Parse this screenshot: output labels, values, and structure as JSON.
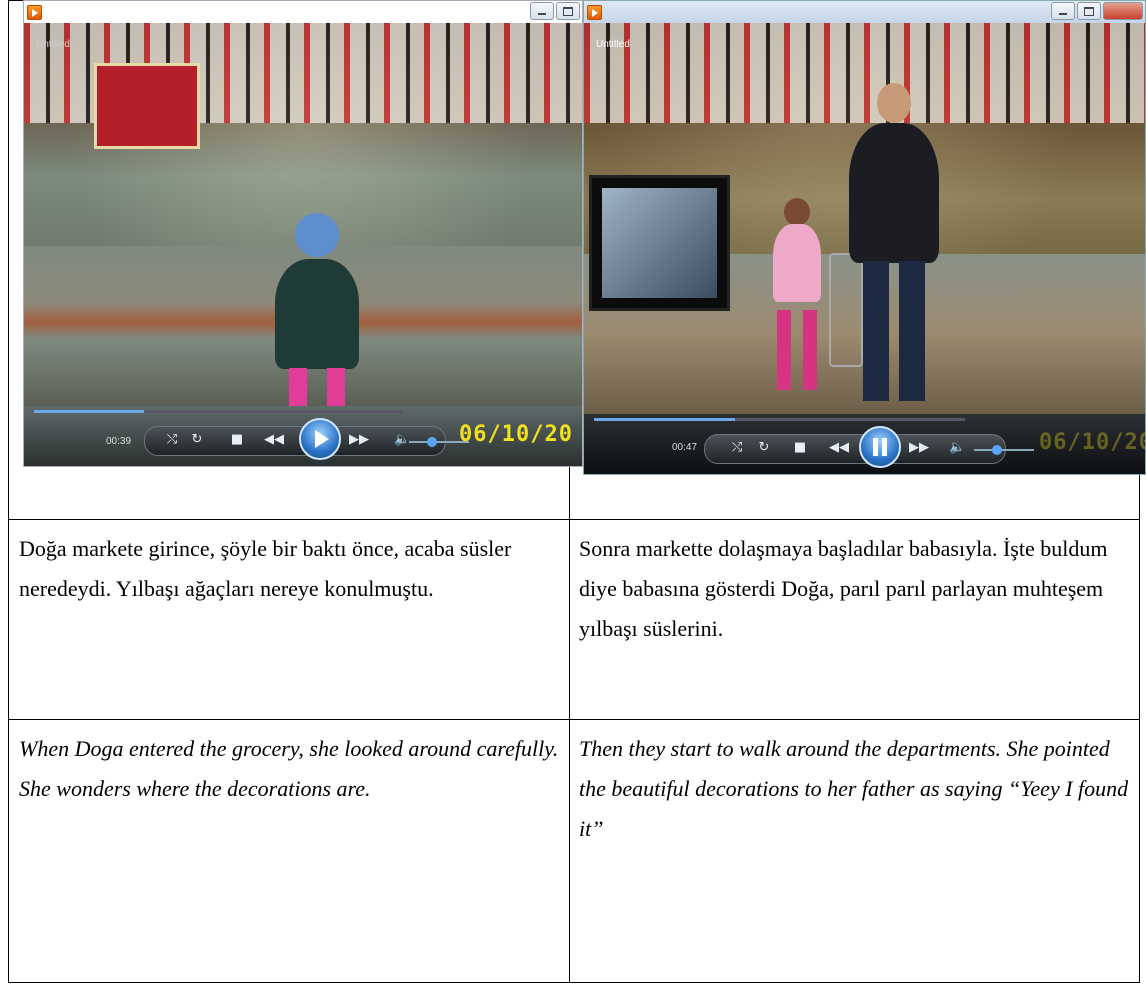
{
  "players": [
    {
      "title": "Untitled",
      "time": "00:39",
      "progress": 0.3,
      "datestamp": "06/10/20",
      "state": "paused",
      "icons": [
        "app-icon",
        "minimize-icon",
        "maximize-icon",
        "shuffle-icon",
        "repeat-icon",
        "stop-icon",
        "previous-icon",
        "play-icon",
        "next-icon",
        "mute-icon"
      ]
    },
    {
      "title": "Untitled",
      "time": "00:47",
      "progress": 0.38,
      "datestamp": "06/10/20",
      "state": "playing",
      "icons": [
        "app-icon",
        "minimize-icon",
        "maximize-icon",
        "close-icon",
        "shuffle-icon",
        "repeat-icon",
        "stop-icon",
        "previous-icon",
        "pause-icon",
        "next-icon",
        "mute-icon"
      ]
    }
  ],
  "table": {
    "turkish": {
      "left": "Doğa markete girince, şöyle bir baktı önce, acaba süsler neredeydi. Yılbaşı ağaçları nereye konulmuştu.",
      "right": "Sonra markette dolaşmaya başladılar babasıyla. İşte buldum diye babasına gösterdi Doğa, parıl parıl parlayan muhteşem yılbaşı süslerini."
    },
    "english": {
      "left": "When Doga entered the grocery, she looked around carefully. She wonders where the decorations are.",
      "right": "Then they start to walk around the departments. She pointed the beautiful decorations to her father as saying “Yeey I found it”"
    }
  }
}
